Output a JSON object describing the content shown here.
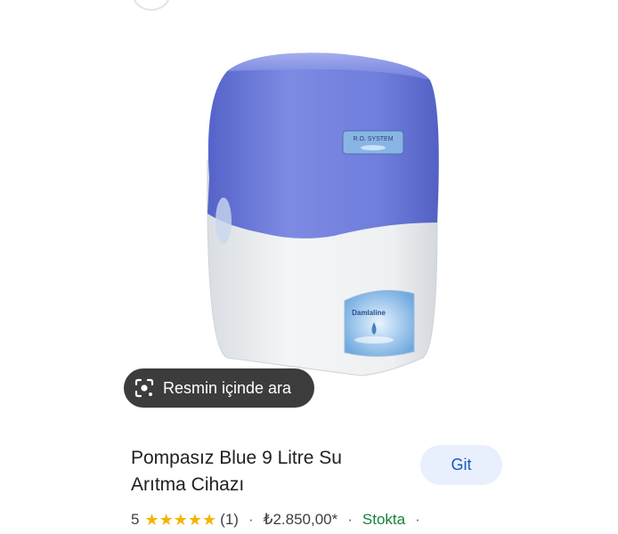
{
  "lens_button": {
    "label": "Resmin içinde ara",
    "icon": "lens-icon"
  },
  "product": {
    "title": "Pompasız Blue 9 Litre Su Arıtma Cihazı",
    "rating": "5",
    "stars_filled": 5,
    "review_count": "(1)",
    "price": "₺2.850,00*",
    "stock": "Stokta",
    "separator": "·",
    "image_label": "R.O. SYSTEM",
    "image_brand": "Damlaline"
  },
  "actions": {
    "go_label": "Git"
  },
  "colors": {
    "accent": "#1a56c4",
    "button_bg": "#e8f0fe",
    "star": "#f4b400",
    "stock": "#188038",
    "device_blue": "#6f7ddc",
    "device_body": "#eef0f2"
  }
}
